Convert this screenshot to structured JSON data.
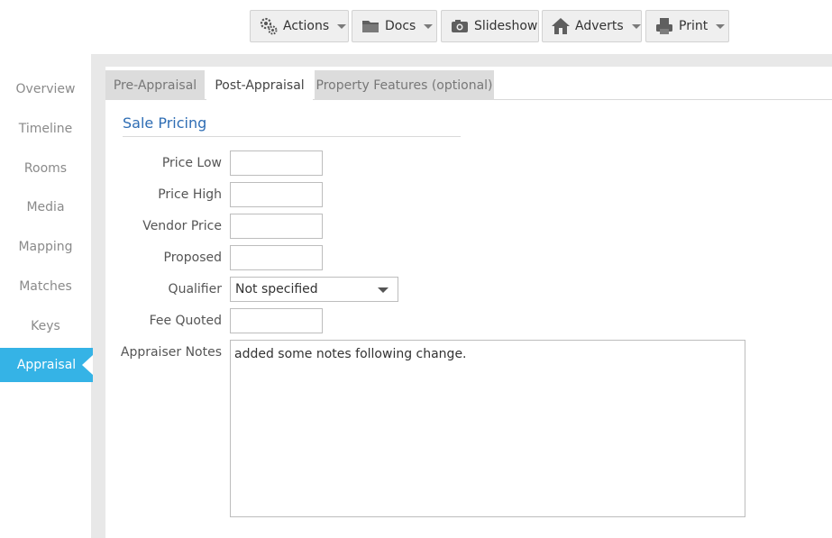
{
  "toolbar": {
    "actions_label": "Actions",
    "docs_label": "Docs",
    "slideshow_label": "Slideshow",
    "adverts_label": "Adverts",
    "print_label": "Print"
  },
  "sidebar": {
    "items": [
      {
        "label": "Overview"
      },
      {
        "label": "Timeline"
      },
      {
        "label": "Rooms"
      },
      {
        "label": "Media"
      },
      {
        "label": "Mapping"
      },
      {
        "label": "Matches"
      },
      {
        "label": "Keys"
      },
      {
        "label": "Appraisal",
        "active": true
      }
    ]
  },
  "tabs": [
    {
      "label": "Pre-Appraisal"
    },
    {
      "label": "Post-Appraisal",
      "active": true
    },
    {
      "label": "Property Features (optional)"
    }
  ],
  "section": {
    "title": "Sale Pricing"
  },
  "form": {
    "price_low_label": "Price Low",
    "price_low_value": "",
    "price_high_label": "Price High",
    "price_high_value": "",
    "vendor_price_label": "Vendor Price",
    "vendor_price_value": "",
    "proposed_label": "Proposed",
    "proposed_value": "",
    "qualifier_label": "Qualifier",
    "qualifier_value": "Not specified",
    "fee_quoted_label": "Fee Quoted",
    "fee_quoted_value": "",
    "appraiser_notes_label": "Appraiser Notes",
    "appraiser_notes_value": "added some notes following change."
  },
  "colors": {
    "accent": "#35b3e6",
    "section_title": "#2e6db4",
    "toolbar_button_bg": "#efefef"
  },
  "icons": {
    "actions": "gears-icon",
    "docs": "folder-icon",
    "slideshow": "camera-icon",
    "adverts": "house-icon",
    "print": "printer-icon"
  }
}
